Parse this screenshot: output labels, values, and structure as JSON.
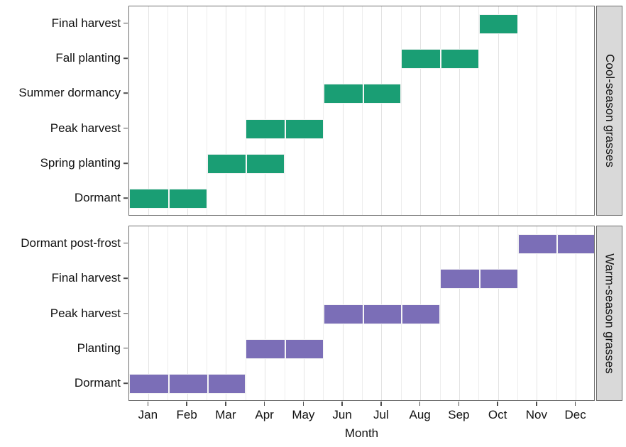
{
  "chart_data": {
    "type": "bar",
    "chart_kind": "gantt-timeline",
    "title": "",
    "xlabel": "Month",
    "ylabel": "",
    "grid": true,
    "legend": false,
    "x_categories": [
      "Jan",
      "Feb",
      "Mar",
      "Apr",
      "May",
      "Jun",
      "Jul",
      "Aug",
      "Sep",
      "Oct",
      "Nov",
      "Dec"
    ],
    "x_index": [
      1,
      2,
      3,
      4,
      5,
      6,
      7,
      8,
      9,
      10,
      11,
      12
    ],
    "xlim": [
      0.5,
      12.5
    ],
    "facets": [
      {
        "name": "cool-season",
        "strip_label": "Cool-season grasses",
        "color": "#1a9e74",
        "y_categories": [
          "Dormant",
          "Spring planting",
          "Peak harvest",
          "Summer dormancy",
          "Fall planting",
          "Final harvest"
        ],
        "tasks": [
          {
            "label": "Final harvest",
            "start_month": 10,
            "end_month": 10,
            "start_label": "Oct",
            "end_label": "Oct",
            "duration_months": 1
          },
          {
            "label": "Fall planting",
            "start_month": 8,
            "end_month": 9,
            "start_label": "Aug",
            "end_label": "Sep",
            "duration_months": 2
          },
          {
            "label": "Summer dormancy",
            "start_month": 6,
            "end_month": 7,
            "start_label": "Jun",
            "end_label": "Jul",
            "duration_months": 2
          },
          {
            "label": "Peak harvest",
            "start_month": 4,
            "end_month": 5,
            "start_label": "Apr",
            "end_label": "May",
            "duration_months": 2
          },
          {
            "label": "Spring planting",
            "start_month": 3,
            "end_month": 4,
            "start_label": "Mar",
            "end_label": "Apr",
            "duration_months": 2
          },
          {
            "label": "Dormant",
            "start_month": 1,
            "end_month": 2,
            "start_label": "Jan",
            "end_label": "Feb",
            "duration_months": 2
          }
        ]
      },
      {
        "name": "warm-season",
        "strip_label": "Warm-season grasses",
        "color": "#7b6eb7",
        "y_categories": [
          "Dormant",
          "Planting",
          "Peak harvest",
          "Final harvest",
          "Dormant post-frost"
        ],
        "tasks": [
          {
            "label": "Dormant post-frost",
            "start_month": 11,
            "end_month": 12,
            "start_label": "Nov",
            "end_label": "Dec",
            "duration_months": 2
          },
          {
            "label": "Final harvest",
            "start_month": 9,
            "end_month": 10,
            "start_label": "Sep",
            "end_label": "Oct",
            "duration_months": 2
          },
          {
            "label": "Peak harvest",
            "start_month": 6,
            "end_month": 8,
            "start_label": "Jun",
            "end_label": "Aug",
            "duration_months": 3
          },
          {
            "label": "Planting",
            "start_month": 4,
            "end_month": 5,
            "start_label": "Apr",
            "end_label": "May",
            "duration_months": 2
          },
          {
            "label": "Dormant",
            "start_month": 1,
            "end_month": 3,
            "start_label": "Jan",
            "end_label": "Mar",
            "duration_months": 3
          }
        ]
      }
    ]
  },
  "axis": {
    "x_title": "Month",
    "x_tick_labels": [
      "Jan",
      "Feb",
      "Mar",
      "Apr",
      "May",
      "Jun",
      "Jul",
      "Aug",
      "Sep",
      "Oct",
      "Nov",
      "Dec"
    ]
  },
  "panels": {
    "top": {
      "strip_label": "Cool-season grasses",
      "y_tick_labels": [
        "Final harvest",
        "Fall planting",
        "Summer dormancy",
        "Peak harvest",
        "Spring planting",
        "Dormant"
      ]
    },
    "bottom": {
      "strip_label": "Warm-season grasses",
      "y_tick_labels": [
        "Dormant post-frost",
        "Final harvest",
        "Peak harvest",
        "Planting",
        "Dormant"
      ]
    }
  },
  "colors": {
    "cool_season_bar": "#1a9e74",
    "warm_season_bar": "#7b6eb7",
    "strip_background": "#d9d9d9",
    "panel_border": "#6e6e6e",
    "gridline": "#ededed"
  }
}
